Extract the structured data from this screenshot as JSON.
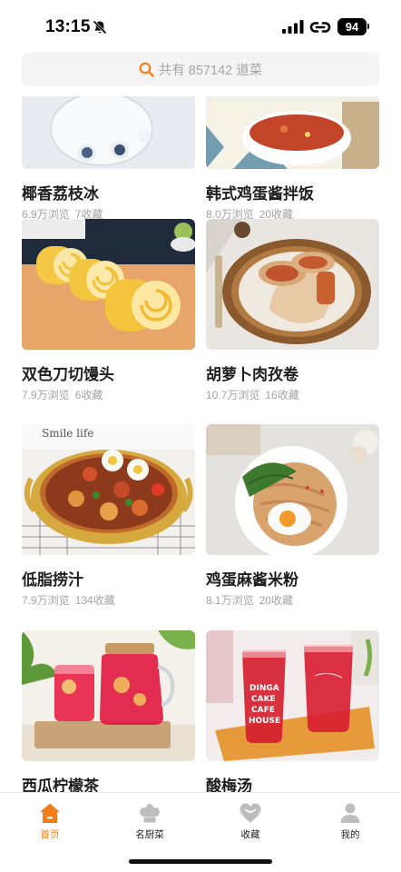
{
  "status_bar": {
    "time": "13:15",
    "battery": "94"
  },
  "search": {
    "placeholder": "共有 857142 道菜"
  },
  "recipes": [
    {
      "title": "椰香荔枝冰",
      "views": "6.9万浏览",
      "favorites": "7收藏"
    },
    {
      "title": "韩式鸡蛋酱拌饭",
      "views": "8.0万浏览",
      "favorites": "20收藏"
    },
    {
      "title": "双色刀切馒头",
      "views": "7.9万浏览",
      "favorites": "6收藏"
    },
    {
      "title": "胡萝卜肉孜卷",
      "views": "10.7万浏览",
      "favorites": "16收藏"
    },
    {
      "title": "低脂捞汁",
      "views": "7.9万浏览",
      "favorites": "134收藏"
    },
    {
      "title": "鸡蛋麻酱米粉",
      "views": "8.1万浏览",
      "favorites": "20收藏"
    },
    {
      "title": "西瓜柠檬茶",
      "views": "",
      "favorites": ""
    },
    {
      "title": "酸梅汤",
      "views": "",
      "favorites": ""
    }
  ],
  "image_text": {
    "pot_brand": "Smile life",
    "drink_cup": [
      "DINGA",
      "CAKE",
      "CAFE",
      "HOUSE"
    ]
  },
  "tabs": [
    {
      "label": "首页",
      "icon": "home-icon",
      "active": true
    },
    {
      "label": "名厨菜",
      "icon": "chef-hat-icon",
      "active": false
    },
    {
      "label": "收藏",
      "icon": "heart-icon",
      "active": false
    },
    {
      "label": "我的",
      "icon": "profile-icon",
      "active": false
    }
  ],
  "colors": {
    "accent": "#f27d1b",
    "inactive_icon": "#bdbdbd"
  }
}
